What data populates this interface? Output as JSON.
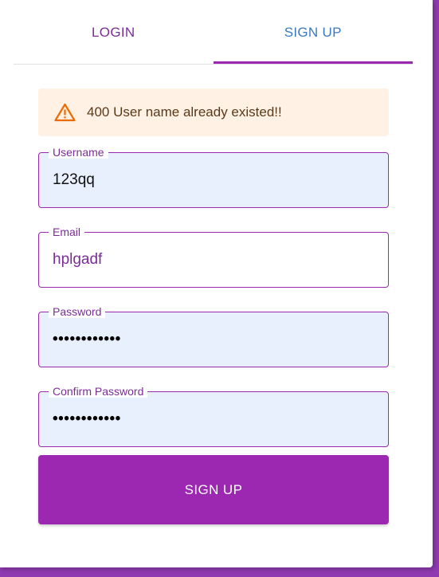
{
  "tabs": [
    {
      "label": "LOGIN",
      "selected": false
    },
    {
      "label": "SIGN UP",
      "selected": true
    }
  ],
  "alert": {
    "icon": "warning-icon",
    "message": "400 User name already existed!!",
    "color": "#ed6c02"
  },
  "fields": {
    "username": {
      "label": "Username",
      "value": "123qq"
    },
    "email": {
      "label": "Email",
      "value": "hplgadf"
    },
    "password": {
      "label": "Password",
      "value": "••••••••••••"
    },
    "confirm_password": {
      "label": "Confirm Password",
      "value": "••••••••••••"
    }
  },
  "submit": {
    "label": "SIGN UP"
  },
  "colors": {
    "primary": "#9c27b0",
    "tab_active_text": "#3a78c2",
    "alert_background": "#fff1e3",
    "autofill_background": "#e8f0fe"
  }
}
